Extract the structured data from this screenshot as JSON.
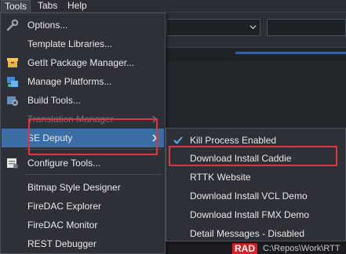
{
  "menubar": {
    "tools": "Tools",
    "tabs": "Tabs",
    "help": "Help"
  },
  "tools_menu": {
    "items": [
      {
        "label": "Options...",
        "icon": "wrench-icon"
      },
      {
        "label": "Template Libraries...",
        "icon": null
      },
      {
        "label": "GetIt Package Manager...",
        "icon": "package-icon"
      },
      {
        "label": "Manage Platforms...",
        "icon": "platforms-icon"
      },
      {
        "label": "Build Tools...",
        "icon": "build-tools-icon"
      },
      {
        "label": "Translation Manager",
        "icon": null,
        "disabled": true,
        "submenu": true
      },
      {
        "label": "SE Deputy",
        "icon": null,
        "highlighted": true,
        "submenu": true
      },
      {
        "label": "Configure Tools...",
        "icon": "configure-icon"
      },
      {
        "label": "Bitmap Style Designer",
        "icon": null
      },
      {
        "label": "FireDAC Explorer",
        "icon": null
      },
      {
        "label": "FireDAC Monitor",
        "icon": null
      },
      {
        "label": "REST Debugger",
        "icon": null
      }
    ]
  },
  "se_deputy_menu": {
    "items": [
      {
        "label": "Kill Process Enabled",
        "checked": true
      },
      {
        "label": "Download Install Caddie"
      },
      {
        "label": "RTTK Website"
      },
      {
        "label": "Download Install VCL Demo"
      },
      {
        "label": "Download Install FMX Demo"
      },
      {
        "label": "Detail Messages - Disabled"
      }
    ]
  },
  "statusbar": {
    "logo": "RAD",
    "path": "C:\\Repos\\Work\\RTT"
  },
  "colors": {
    "highlight": "#3a6ea5",
    "annotation_red": "#e0353d"
  }
}
